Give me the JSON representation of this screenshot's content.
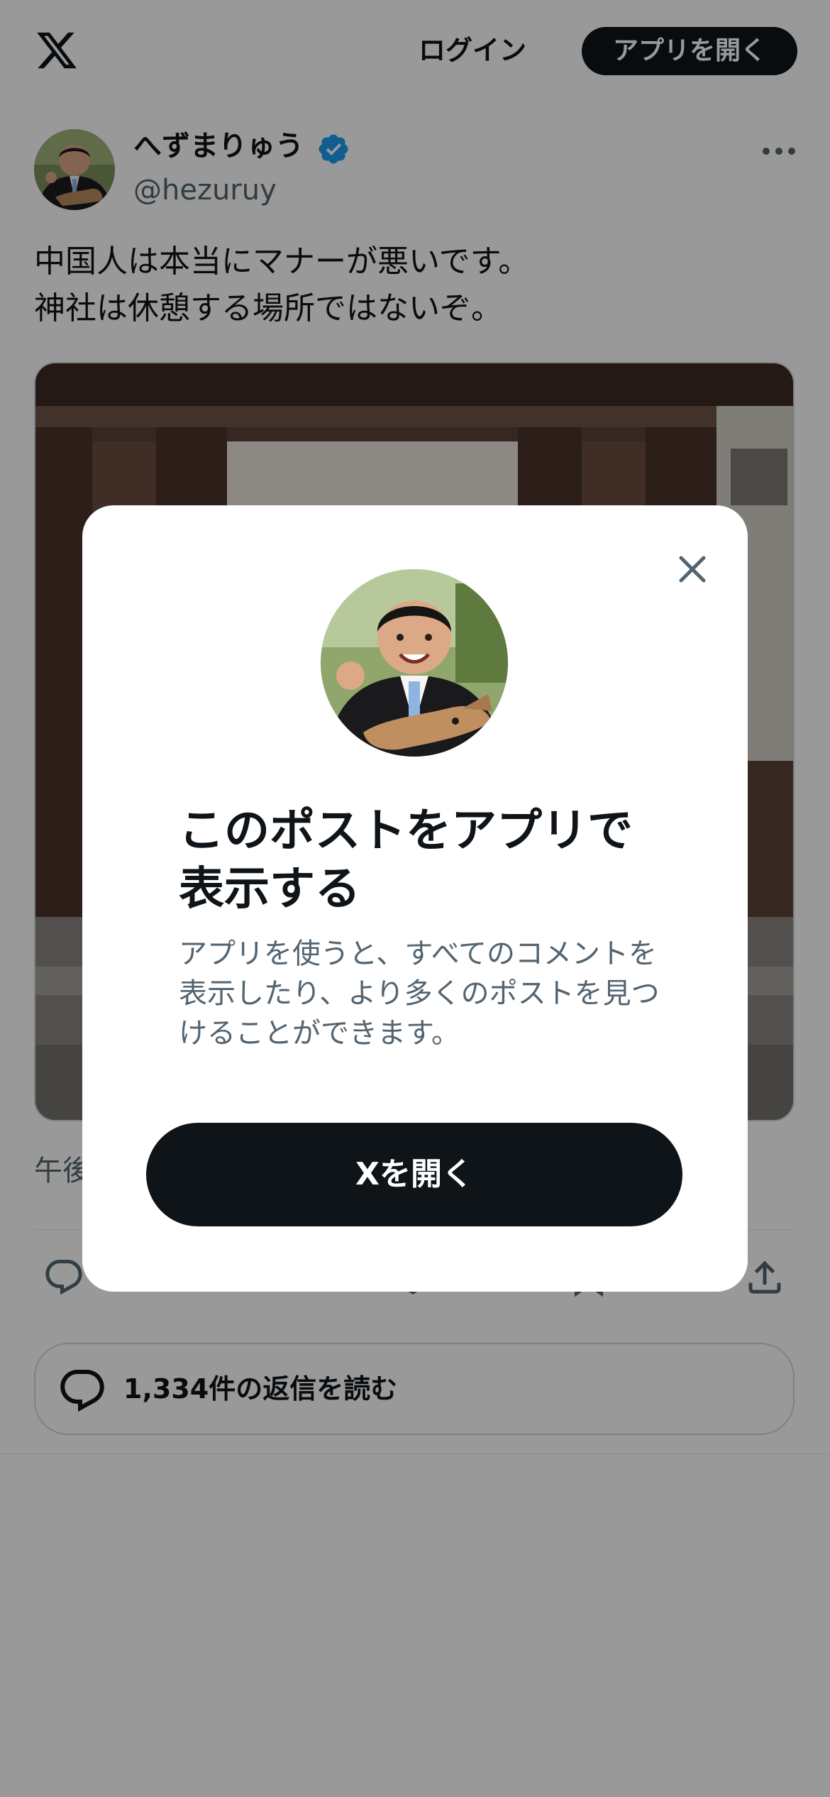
{
  "header": {
    "logo": "x-logo-icon",
    "login_label": "ログイン",
    "open_app_label": "アプリを開く"
  },
  "post": {
    "author": {
      "display_name": "へずまりゅう",
      "handle": "@hezuruy",
      "verified": true
    },
    "text": "中国人は本当にマナーが悪いです。\n神社は休憩する場所ではないぞ。",
    "timestamp_partial": "午後",
    "actions": [
      "reply-icon",
      "repost-icon",
      "like-icon",
      "bookmark-icon",
      "share-icon"
    ],
    "read_replies_label": "1,334件の返信を読む"
  },
  "modal": {
    "title": "このポストをアプリで表示する",
    "description": "アプリを使うと、すべてのコメントを表示したり、より多くのポストを見つけることができます。",
    "button_label": "Xを開く",
    "close_icon": "close-icon"
  },
  "colors": {
    "text_primary": "#0f1419",
    "text_secondary": "#536471",
    "verified_blue": "#1d9bf0",
    "button_dark": "#0f1419",
    "overlay": "rgba(0,0,0,0.40)"
  }
}
